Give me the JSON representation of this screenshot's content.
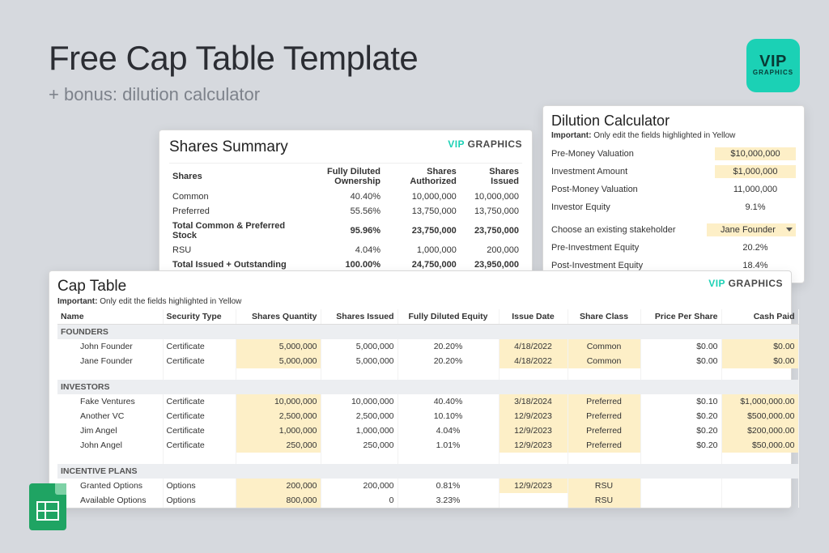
{
  "header": {
    "title": "Free Cap Table Template",
    "subtitle": "+ bonus: dilution calculator",
    "badge_vip": "VIP",
    "badge_sub": "GRAPHICS"
  },
  "vip_logo": {
    "left": "VIP",
    "right": " GRAPHICS"
  },
  "shares_summary": {
    "title": "Shares Summary",
    "cols": [
      "Shares",
      "Fully Diluted Ownership",
      "Shares Authorized",
      "Shares Issued"
    ],
    "rows": [
      {
        "label": "Common",
        "own": "40.40%",
        "auth": "10,000,000",
        "issued": "10,000,000",
        "bold": false
      },
      {
        "label": "Preferred",
        "own": "55.56%",
        "auth": "13,750,000",
        "issued": "13,750,000",
        "bold": false
      },
      {
        "label": "Total Common & Preferred Stock",
        "own": "95.96%",
        "auth": "23,750,000",
        "issued": "23,750,000",
        "bold": true
      },
      {
        "label": "RSU",
        "own": "4.04%",
        "auth": "1,000,000",
        "issued": "200,000",
        "bold": false
      },
      {
        "label": "Total Issued + Outstanding",
        "own": "100.00%",
        "auth": "24,750,000",
        "issued": "23,950,000",
        "bold": true
      }
    ]
  },
  "dilution": {
    "title": "Dilution Calculator",
    "important_label": "Important:",
    "important_text": " Only edit the fields highlighted in Yellow",
    "rows1": [
      {
        "label": "Pre-Money Valuation",
        "value": "$10,000,000",
        "hl": true
      },
      {
        "label": "Investment Amount",
        "value": "$1,000,000",
        "hl": true
      },
      {
        "label": "Post-Money Valuation",
        "value": "11,000,000",
        "hl": false
      },
      {
        "label": "Investor Equity",
        "value": "9.1%",
        "hl": false
      }
    ],
    "stakeholder_label": "Choose an existing stakeholder",
    "stakeholder_value": "Jane Founder",
    "rows2": [
      {
        "label": "Pre-Investment Equity",
        "value": "20.2%"
      },
      {
        "label": "Post-Investment Equity",
        "value": "18.4%"
      }
    ]
  },
  "cap_table": {
    "title": "Cap Table",
    "important_label": "Important:",
    "important_text": " Only edit the fields highlighted in Yellow",
    "cols": [
      "Name",
      "Security Type",
      "Shares Quantity",
      "Shares Issued",
      "Fully Diluted Equity",
      "Issue Date",
      "Share Class",
      "Price Per Share",
      "Cash Paid"
    ],
    "sections": [
      {
        "heading": "FOUNDERS",
        "rows": [
          {
            "name": "John Founder",
            "sec": "Certificate",
            "qty": "5,000,000",
            "iss": "5,000,000",
            "eq": "20.20%",
            "date": "4/18/2022",
            "cls": "Common",
            "pps": "$0.00",
            "cash": "$0.00"
          },
          {
            "name": "Jane Founder",
            "sec": "Certificate",
            "qty": "5,000,000",
            "iss": "5,000,000",
            "eq": "20.20%",
            "date": "4/18/2022",
            "cls": "Common",
            "pps": "$0.00",
            "cash": "$0.00"
          }
        ]
      },
      {
        "heading": "INVESTORS",
        "rows": [
          {
            "name": "Fake Ventures",
            "sec": "Certificate",
            "qty": "10,000,000",
            "iss": "10,000,000",
            "eq": "40.40%",
            "date": "3/18/2024",
            "cls": "Preferred",
            "pps": "$0.10",
            "cash": "$1,000,000.00"
          },
          {
            "name": "Another VC",
            "sec": "Certificate",
            "qty": "2,500,000",
            "iss": "2,500,000",
            "eq": "10.10%",
            "date": "12/9/2023",
            "cls": "Preferred",
            "pps": "$0.20",
            "cash": "$500,000.00"
          },
          {
            "name": "Jim Angel",
            "sec": "Certificate",
            "qty": "1,000,000",
            "iss": "1,000,000",
            "eq": "4.04%",
            "date": "12/9/2023",
            "cls": "Preferred",
            "pps": "$0.20",
            "cash": "$200,000.00"
          },
          {
            "name": "John Angel",
            "sec": "Certificate",
            "qty": "250,000",
            "iss": "250,000",
            "eq": "1.01%",
            "date": "12/9/2023",
            "cls": "Preferred",
            "pps": "$0.20",
            "cash": "$50,000.00"
          }
        ]
      },
      {
        "heading": "INCENTIVE PLANS",
        "rows": [
          {
            "name": "Granted Options",
            "sec": "Options",
            "qty": "200,000",
            "iss": "200,000",
            "eq": "0.81%",
            "date": "12/9/2023",
            "cls": "RSU",
            "pps": "",
            "cash": ""
          },
          {
            "name": "Available Options",
            "sec": "Options",
            "qty": "800,000",
            "iss": "0",
            "eq": "3.23%",
            "date": "",
            "cls": "RSU",
            "pps": "",
            "cash": ""
          }
        ]
      }
    ]
  }
}
